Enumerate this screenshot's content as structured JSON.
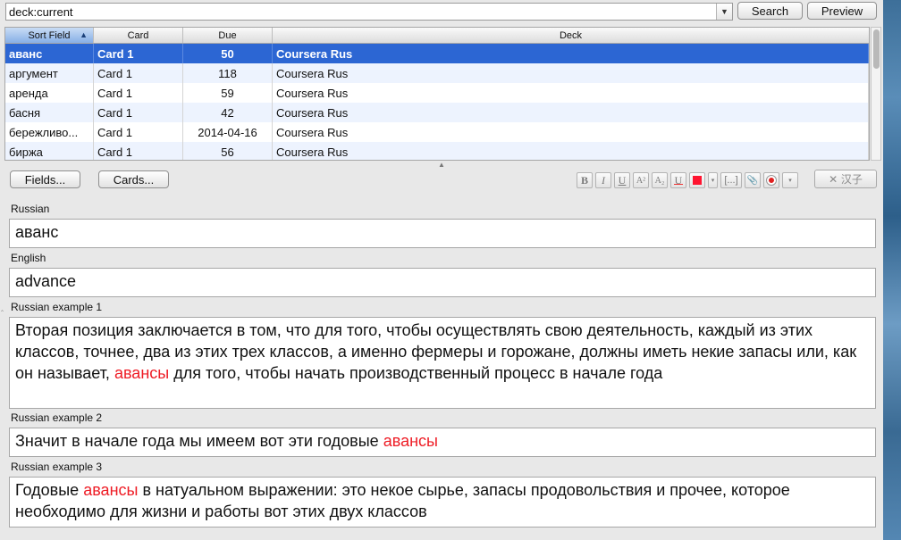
{
  "search": {
    "query": "deck:current",
    "search_label": "Search",
    "preview_label": "Preview"
  },
  "table": {
    "columns": [
      "Sort Field",
      "Card",
      "Due",
      "Deck"
    ],
    "sort_indicator": "▲",
    "rows": [
      {
        "sort_field": "аванс",
        "card": "Card 1",
        "due": "50",
        "deck": "Coursera Rus"
      },
      {
        "sort_field": "аргумент",
        "card": "Card 1",
        "due": "118",
        "deck": "Coursera Rus"
      },
      {
        "sort_field": "аренда",
        "card": "Card 1",
        "due": "59",
        "deck": "Coursera Rus"
      },
      {
        "sort_field": "басня",
        "card": "Card 1",
        "due": "42",
        "deck": "Coursera Rus"
      },
      {
        "sort_field": "бережливо...",
        "card": "Card 1",
        "due": "2014-04-16",
        "deck": "Coursera Rus"
      },
      {
        "sort_field": "биржа",
        "card": "Card 1",
        "due": "56",
        "deck": "Coursera Rus"
      }
    ],
    "selected_row": 0
  },
  "editor": {
    "fields_label": "Fields...",
    "cards_label": "Cards...",
    "toolbar": {
      "bold": "B",
      "italic": "I",
      "underline": "U",
      "superscript": "A²",
      "subscript": "A₂",
      "clear_format": "U",
      "color_dropdown": "▾",
      "cloze": "[...]",
      "attach": "📎",
      "more": "▾"
    },
    "chinese_button": "✕ 汉子",
    "fields": [
      {
        "label": "Russian",
        "parts": [
          {
            "text": "аванс",
            "hl": false
          }
        ]
      },
      {
        "label": "English",
        "parts": [
          {
            "text": "advance",
            "hl": false
          }
        ]
      },
      {
        "label": "Russian example 1",
        "parts": [
          {
            "text": "Вторая позиция заключается в том, что для того, чтобы осуществлять свою деятельность, каждый из этих классов, точнее, два из этих трех классов, а именно фермеры и горожане, должны иметь некие запасы или, как он называет, ",
            "hl": false
          },
          {
            "text": "авансы",
            "hl": true
          },
          {
            "text": " для того, чтобы начать производственный процесс в начале года",
            "hl": false
          }
        ]
      },
      {
        "label": "Russian example 2",
        "parts": [
          {
            "text": "Значит в начале года мы имеем вот эти годовые ",
            "hl": false
          },
          {
            "text": "авансы",
            "hl": true
          }
        ]
      },
      {
        "label": "Russian example 3",
        "parts": [
          {
            "text": "Годовые ",
            "hl": false
          },
          {
            "text": "авансы",
            "hl": true
          },
          {
            "text": " в натуальном выражении: это некое сырье, запасы продовольствия и прочее, которое необходимо для жизни и работы вот этих двух классов",
            "hl": false
          }
        ]
      }
    ]
  },
  "colors": {
    "selection": "#2c66d3",
    "highlight_text": "#ee1b24",
    "font_color_swatch": "#ff1430"
  }
}
